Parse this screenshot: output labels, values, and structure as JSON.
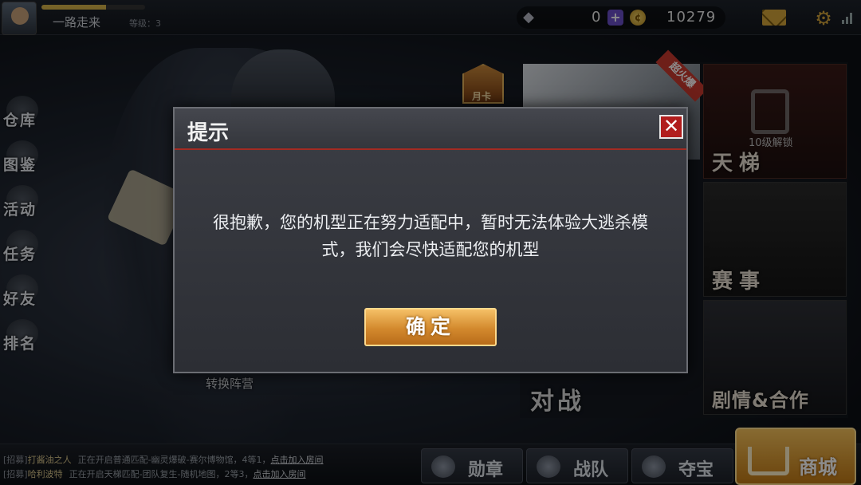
{
  "player": {
    "name": "一路走来",
    "level_label": "等级：3",
    "xp_fraction": 0.62
  },
  "currency": {
    "diamonds": "0",
    "coins": "10279"
  },
  "left_menu": [
    {
      "label": "仓库"
    },
    {
      "label": "图鉴"
    },
    {
      "label": "活动"
    },
    {
      "label": "任务"
    },
    {
      "label": "好友"
    },
    {
      "label": "排名"
    }
  ],
  "monthly_card_label": "月卡",
  "promo_ribbon": "超火爆",
  "switch_camp_label": "转换阵营",
  "tiles": {
    "ladder": "天梯",
    "ladder_lock": "10级解锁",
    "contest": "赛事",
    "story": "剧情&合作",
    "battle": "对战"
  },
  "chat": [
    {
      "tag": "[招募]",
      "name": "打酱油之人",
      "body": "正在开启普通匹配-幽灵爆破-赛尔博物馆，4等1，",
      "join": "点击加入房间"
    },
    {
      "tag": "[招募]",
      "name": "哈利波特",
      "body": "正在开启天梯匹配-团队复生-随机地图，2等3，",
      "join": "点击加入房间"
    }
  ],
  "bottom_nav": {
    "medal": "勋章",
    "team": "战队",
    "loot": "夺宝",
    "shop": "商城"
  },
  "dialog": {
    "title": "提示",
    "message": "很抱歉，您的机型正在努力适配中，暂时无法体验大逃杀模式，我们会尽快适配您的机型",
    "confirm": "确定"
  }
}
